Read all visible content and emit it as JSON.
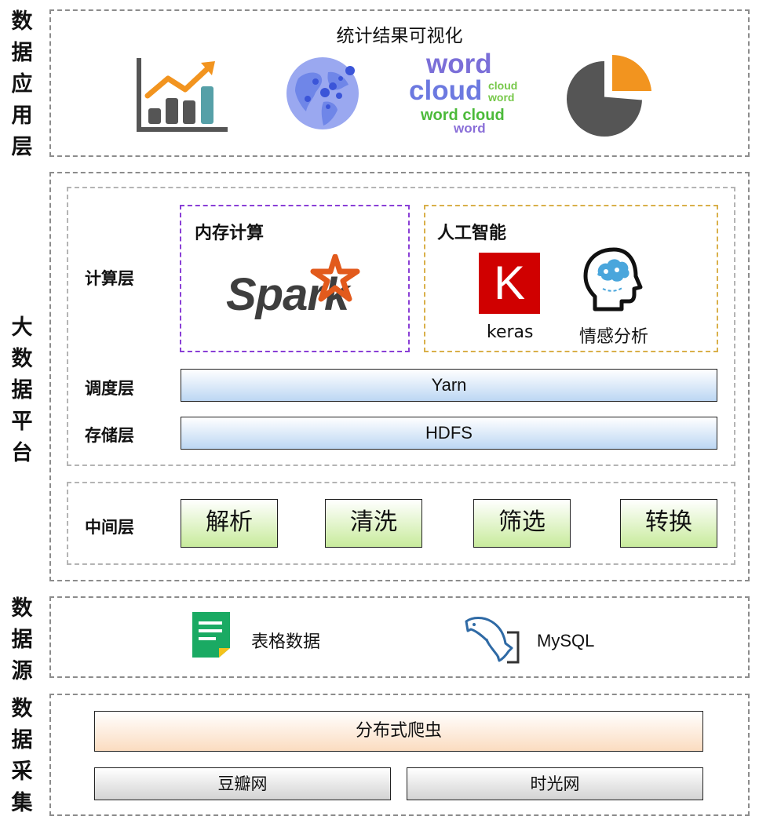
{
  "layers": {
    "application": "数据应用层",
    "platform": "大数据平台",
    "source": "数据源",
    "collection": "数据采集"
  },
  "visualization": {
    "title": "统计结果可视化",
    "icons": [
      "line-bar-chart-icon",
      "globe-icon",
      "word-cloud-icon",
      "pie-chart-icon"
    ],
    "wordcloud": {
      "w1": "word",
      "w2": "cloud",
      "w3": "cloud",
      "w4": "word",
      "w5": "word cloud",
      "w6": "word"
    }
  },
  "compute": {
    "label": "计算层",
    "memory_title": "内存计算",
    "spark_text": "Spark",
    "ai_title": "人工智能",
    "keras_letter": "K",
    "keras_label": "keras",
    "sentiment_label": "情感分析"
  },
  "schedule": {
    "label": "调度层",
    "name": "Yarn"
  },
  "storage": {
    "label": "存储层",
    "name": "HDFS"
  },
  "middle": {
    "label": "中间层",
    "items": [
      "解析",
      "清洗",
      "筛选",
      "转换"
    ]
  },
  "sources": {
    "table": "表格数据",
    "mysql": "MySQL"
  },
  "crawler": {
    "title": "分布式爬虫",
    "sites": [
      "豆瓣网",
      "时光网"
    ]
  },
  "colors": {
    "spark_orange": "#e25a1c",
    "keras_red": "#d00000",
    "ai_border": "#d9b04a",
    "memory_border": "#8a3fd6"
  }
}
